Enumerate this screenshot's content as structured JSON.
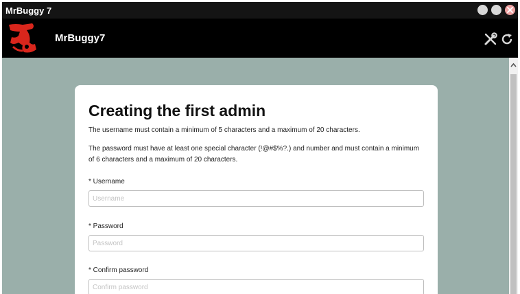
{
  "window": {
    "title": "MrBuggy 7"
  },
  "appbar": {
    "app_name": "MrBuggy7",
    "icons": [
      "logo",
      "wrench-screwdriver-icon",
      "refresh-icon"
    ]
  },
  "form": {
    "title": "Creating the first admin",
    "username_rule": "The username must contain a minimum of 5 characters and a maximum of 20 characters.",
    "password_rule": "The password must have at least one special character (!@#$%?.) and number and must contain a minimum of 6 characters and a maximum of 20 characters.",
    "fields": [
      {
        "label": "* Username",
        "placeholder": "Username",
        "value": ""
      },
      {
        "label": "* Password",
        "placeholder": "Password",
        "value": ""
      },
      {
        "label": "* Confirm password",
        "placeholder": "Confirm password",
        "value": ""
      }
    ]
  },
  "colors": {
    "titlebar": "#141414",
    "appbar": "#000000",
    "background": "#9aafaa",
    "card": "#ffffff",
    "logo": "#d9261c"
  }
}
